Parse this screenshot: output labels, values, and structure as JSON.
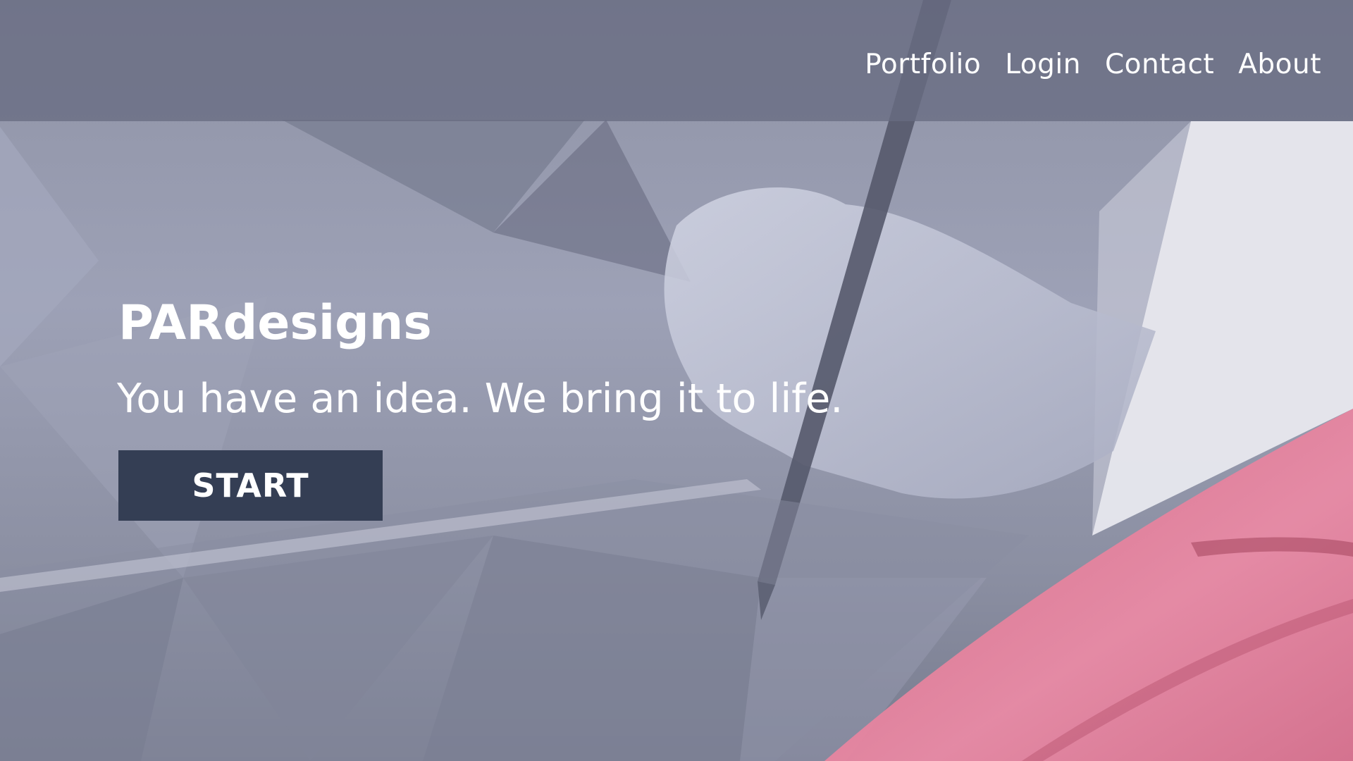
{
  "nav": {
    "items": [
      {
        "label": "Portfolio"
      },
      {
        "label": "Login"
      },
      {
        "label": "Contact"
      },
      {
        "label": "About"
      }
    ]
  },
  "hero": {
    "brand": "PARdesigns",
    "tagline": "You have an idea. We bring it to life.",
    "cta_label": "START",
    "background_image": "hand-with-stylus-on-drawing-tablet",
    "accent_color": "#e07893",
    "button_color": "#343e54",
    "overlay_color": "#686c82"
  }
}
